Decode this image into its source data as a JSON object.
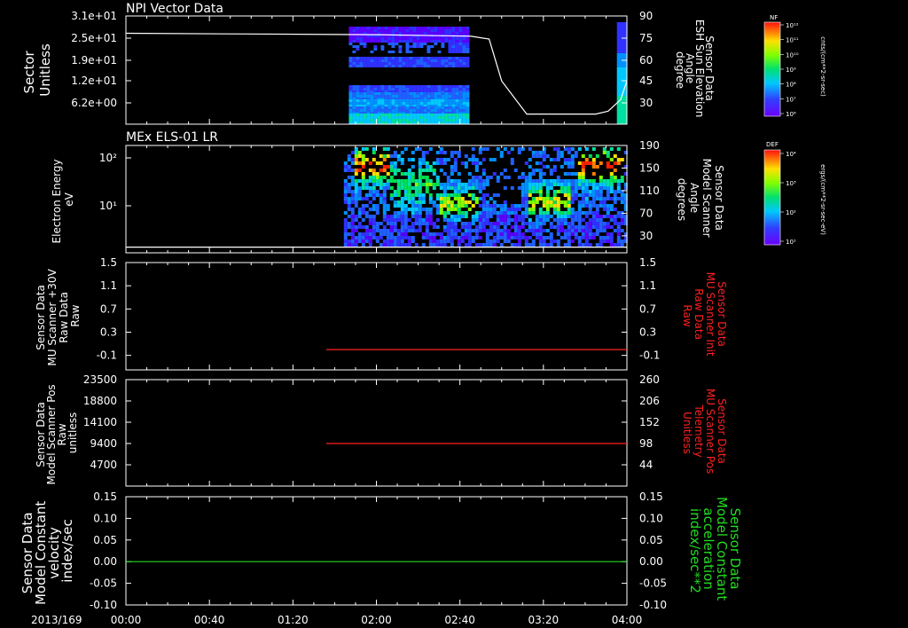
{
  "chart_data": [
    {
      "type": "heatmap",
      "title": "NPI Vector Data",
      "ylabel": [
        "Sector",
        "Unitless"
      ],
      "y_ticks": [
        "3.1e+01",
        "2.5e+01",
        "1.9e+01",
        "1.2e+01",
        "6.2e+00"
      ],
      "y_right_label": [
        "Sensor Data",
        "ESH Sun Elevation",
        "Angle",
        "degree"
      ],
      "y_right_ticks": [
        "90",
        "75",
        "60",
        "45",
        "30"
      ],
      "y_right_range": [
        15,
        90
      ],
      "overlay_line": {
        "color": "#ffffff",
        "x_hours": [
          0,
          1.0,
          2.0,
          2.75,
          2.9,
          3.0,
          3.2,
          3.4,
          3.75,
          3.85,
          3.95,
          4.0
        ],
        "y_values": [
          78,
          77.5,
          77,
          76,
          74,
          45,
          22,
          22,
          22,
          24,
          32,
          45
        ]
      },
      "colorbar": {
        "label": "NF",
        "unit": "cnts/(cm**2-sr-sec)",
        "ticks": [
          "10¹²",
          "10¹¹",
          "10¹⁰",
          "10⁹",
          "10⁸",
          "10⁷",
          "10⁶"
        ]
      }
    },
    {
      "type": "heatmap",
      "title": "MEx ELS-01 LR",
      "ylabel": [
        "Electron Energy",
        "eV"
      ],
      "y_ticks": [
        "10²",
        "10¹"
      ],
      "y_right_label": [
        "Sensor Data",
        "Model Scanner",
        "Angle",
        "degrees"
      ],
      "y_right_ticks": [
        "190",
        "150",
        "110",
        "70",
        "30"
      ],
      "y_right_range": [
        0,
        190
      ],
      "overlay_line": {
        "color": "#ffffff",
        "x_hours": [
          0,
          4.0
        ],
        "y_values": [
          10,
          10
        ]
      },
      "colorbar": {
        "label": "DEF",
        "unit": "ergs/(cm**2-sr-sec-eV)",
        "ticks": [
          "10⁴",
          "10³",
          "10²",
          "10¹"
        ]
      }
    },
    {
      "type": "line",
      "ylabel": [
        "Sensor Data",
        "MU Scanner +30V",
        "Raw Data",
        "Raw"
      ],
      "y_ticks": [
        "1.5",
        "1.1",
        "0.7",
        "0.3",
        "-0.1"
      ],
      "y_right_label": [
        "Sensor Data",
        "MU Scanner Init",
        "Raw Data",
        "Raw"
      ],
      "y_right_ticks": [
        "1.5",
        "1.1",
        "0.7",
        "0.3",
        "-0.1"
      ],
      "ylim": [
        -0.35,
        1.5
      ],
      "series": [
        {
          "color": "#ff2020",
          "x_hours": [
            1.6,
            4.0
          ],
          "values": [
            0.0,
            0.0
          ]
        }
      ]
    },
    {
      "type": "line",
      "ylabel": [
        "Sensor Data",
        "Model Scanner Pos",
        "Raw",
        "unitless"
      ],
      "y_ticks": [
        "23500",
        "18800",
        "14100",
        "9400",
        "4700"
      ],
      "y_right_label": [
        "Sensor Data",
        "MU Scanner Pos",
        "Telemetry",
        "Unitless"
      ],
      "y_right_ticks": [
        "260",
        "206",
        "152",
        "98",
        "44"
      ],
      "ylim": [
        0,
        23500
      ],
      "series": [
        {
          "color": "#ff2020",
          "x_hours": [
            1.6,
            4.0
          ],
          "values": [
            9400,
            9400
          ]
        }
      ]
    },
    {
      "type": "line",
      "ylabel": [
        "Sensor Data",
        "Model Constant",
        "velocity",
        "index/sec"
      ],
      "y_ticks": [
        "0.15",
        "0.10",
        "0.05",
        "0.00",
        "-0.05",
        "-0.10"
      ],
      "y_right_label": [
        "Sensor Data",
        "Model Constant",
        "acceleration",
        "index/sec**2"
      ],
      "y_right_ticks": [
        "0.15",
        "0.10",
        "0.05",
        "0.00",
        "-0.05",
        "-0.10"
      ],
      "ylim": [
        -0.1,
        0.15
      ],
      "series": [
        {
          "color": "#22dd22",
          "x_hours": [
            0,
            4.0
          ],
          "values": [
            0.0,
            0.0
          ]
        }
      ]
    }
  ],
  "x_axis": {
    "date_label": "2013/169",
    "ticks": [
      "00:00",
      "00:40",
      "01:20",
      "02:00",
      "02:40",
      "03:20",
      "04:00"
    ],
    "range_hours": [
      0,
      4
    ]
  },
  "colors": {
    "background": "#000000",
    "axis": "#ffffff",
    "right_label_red": "#ff2020",
    "right_label_green": "#22dd22"
  }
}
